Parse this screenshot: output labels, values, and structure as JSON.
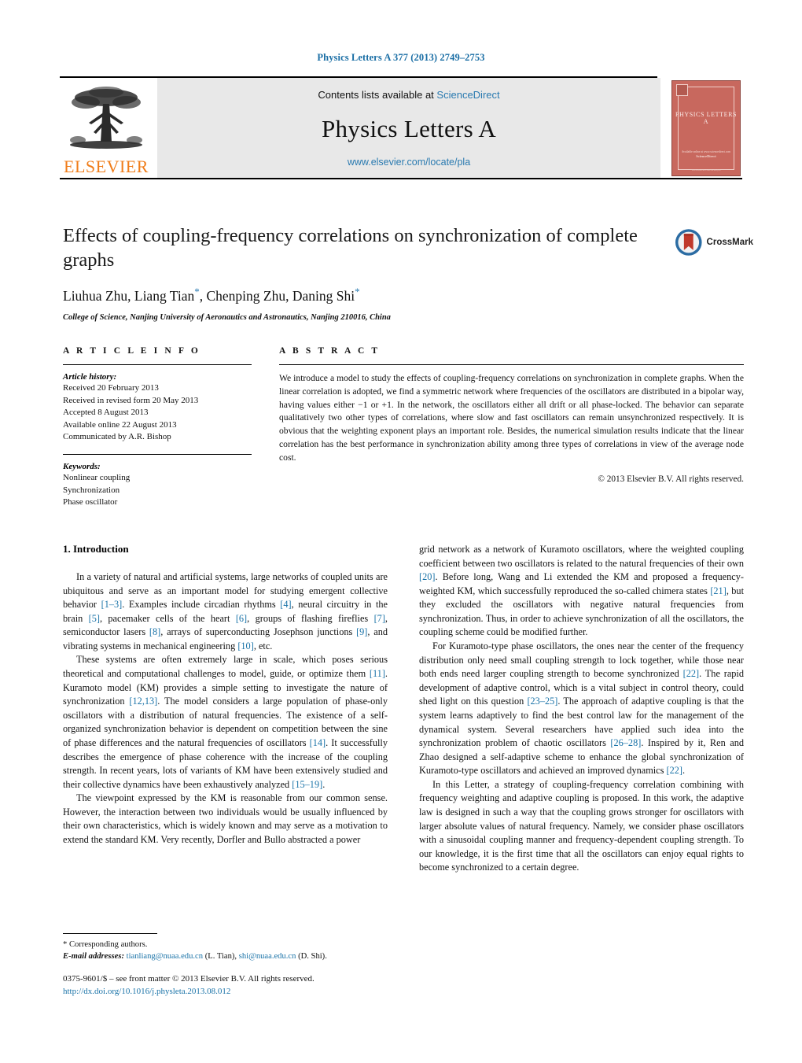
{
  "running_head": "Physics Letters A 377 (2013) 2749–2753",
  "masthead": {
    "contents_prefix": "Contents lists available at",
    "sciencedirect": "ScienceDirect",
    "journal_name": "Physics Letters A",
    "journal_url": "www.elsevier.com/locate/pla",
    "publisher_wordmark": "ELSEVIER",
    "cover_title": "PHYSICS LETTERS A",
    "cover_footer_line1": "Available online at www.sciencedirect.com",
    "cover_footer_line2": "ScienceDirect",
    "cover_bottom": "www.elsevier.com/locate/pla"
  },
  "article": {
    "title": "Effects of coupling-frequency correlations on synchronization of complete graphs",
    "authors": "Liuhua Zhu, Liang Tian",
    "authors_mid": ", Chenping Zhu, Daning Shi",
    "corresponding_mark": "*",
    "affiliation": "College of Science, Nanjing University of Aeronautics and Astronautics, Nanjing 210016, China",
    "crossmark_label": "CrossMark"
  },
  "info": {
    "heading": "A R T I C L E   I N F O",
    "history_label": "Article history:",
    "history": [
      "Received 20 February 2013",
      "Received in revised form 20 May 2013",
      "Accepted 8 August 2013",
      "Available online 22 August 2013",
      "Communicated by A.R. Bishop"
    ],
    "keywords_label": "Keywords:",
    "keywords": [
      "Nonlinear coupling",
      "Synchronization",
      "Phase oscillator"
    ]
  },
  "abstract": {
    "heading": "A B S T R A C T",
    "text": "We introduce a model to study the effects of coupling-frequency correlations on synchronization in complete graphs. When the linear correlation is adopted, we find a symmetric network where frequencies of the oscillators are distributed in a bipolar way, having values either −1 or +1. In the network, the oscillators either all drift or all phase-locked. The behavior can separate qualitatively two other types of correlations, where slow and fast oscillators can remain unsynchronized respectively. It is obvious that the weighting exponent plays an important role. Besides, the numerical simulation results indicate that the linear correlation has the best performance in synchronization ability among three types of correlations in view of the average node cost.",
    "copyright": "© 2013 Elsevier B.V. All rights reserved."
  },
  "body": {
    "section_title": "1. Introduction",
    "left_paragraphs": [
      {
        "parts": [
          {
            "t": "In a variety of natural and artificial systems, large networks of coupled units are ubiquitous and serve as an important model for studying emergent collective behavior "
          },
          {
            "t": "[1–3]",
            "ref": true
          },
          {
            "t": ". Examples include circadian rhythms "
          },
          {
            "t": "[4]",
            "ref": true
          },
          {
            "t": ", neural circuitry in the brain "
          },
          {
            "t": "[5]",
            "ref": true
          },
          {
            "t": ", pacemaker cells of the heart "
          },
          {
            "t": "[6]",
            "ref": true
          },
          {
            "t": ", groups of flashing fireflies "
          },
          {
            "t": "[7]",
            "ref": true
          },
          {
            "t": ", semiconductor lasers "
          },
          {
            "t": "[8]",
            "ref": true
          },
          {
            "t": ", arrays of superconducting Josephson junctions "
          },
          {
            "t": "[9]",
            "ref": true
          },
          {
            "t": ", and vibrating systems in mechanical engineering "
          },
          {
            "t": "[10]",
            "ref": true
          },
          {
            "t": ", etc."
          }
        ]
      },
      {
        "parts": [
          {
            "t": "These systems are often extremely large in scale, which poses serious theoretical and computational challenges to model, guide, or optimize them "
          },
          {
            "t": "[11]",
            "ref": true
          },
          {
            "t": ". Kuramoto model (KM) provides a simple setting to investigate the nature of synchronization "
          },
          {
            "t": "[12,13]",
            "ref": true
          },
          {
            "t": ". The model considers a large population of phase-only oscillators with a distribution of natural frequencies. The existence of a self-organized synchronization behavior is dependent on competition between the sine of phase differences and the natural frequencies of oscillators "
          },
          {
            "t": "[14]",
            "ref": true
          },
          {
            "t": ". It successfully describes the emergence of phase coherence with the increase of the coupling strength. In recent years, lots of variants of KM have been extensively studied and their collective dynamics have been exhaustively analyzed "
          },
          {
            "t": "[15–19]",
            "ref": true
          },
          {
            "t": "."
          }
        ]
      },
      {
        "parts": [
          {
            "t": "The viewpoint expressed by the KM is reasonable from our common sense. However, the interaction between two individuals would be usually influenced by their own characteristics, which is widely known and may serve as a motivation to extend the standard KM. Very recently, Dorfler and Bullo abstracted a power"
          }
        ]
      }
    ],
    "right_paragraphs": [
      {
        "no_indent": true,
        "parts": [
          {
            "t": "grid network as a network of Kuramoto oscillators, where the weighted coupling coefficient between two oscillators is related to the natural frequencies of their own "
          },
          {
            "t": "[20]",
            "ref": true
          },
          {
            "t": ". Before long, Wang and Li extended the KM and proposed a frequency-weighted KM, which successfully reproduced the so-called chimera states "
          },
          {
            "t": "[21]",
            "ref": true
          },
          {
            "t": ", but they excluded the oscillators with negative natural frequencies from synchronization. Thus, in order to achieve synchronization of all the oscillators, the coupling scheme could be modified further."
          }
        ]
      },
      {
        "parts": [
          {
            "t": "For Kuramoto-type phase oscillators, the ones near the center of the frequency distribution only need small coupling strength to lock together, while those near both ends need larger coupling strength to become synchronized "
          },
          {
            "t": "[22]",
            "ref": true
          },
          {
            "t": ". The rapid development of adaptive control, which is a vital subject in control theory, could shed light on this question "
          },
          {
            "t": "[23–25]",
            "ref": true
          },
          {
            "t": ". The approach of adaptive coupling is that the system learns adaptively to find the best control law for the management of the dynamical system. Several researchers have applied such idea into the synchronization problem of chaotic oscillators "
          },
          {
            "t": "[26–28]",
            "ref": true
          },
          {
            "t": ". Inspired by it, Ren and Zhao designed a self-adaptive scheme to enhance the global synchronization of Kuramoto-type oscillators and achieved an improved dynamics "
          },
          {
            "t": "[22]",
            "ref": true
          },
          {
            "t": "."
          }
        ]
      },
      {
        "parts": [
          {
            "t": "In this Letter, a strategy of coupling-frequency correlation combining with frequency weighting and adaptive coupling is proposed. In this work, the adaptive law is designed in such a way that the coupling grows stronger for oscillators with larger absolute values of natural frequency. Namely, we consider phase oscillators with a sinusoidal coupling manner and frequency-dependent coupling strength. To our knowledge, it is the first time that all the oscillators can enjoy equal rights to become synchronized to a certain degree."
          }
        ]
      }
    ]
  },
  "footnote": {
    "corresponding": "Corresponding authors.",
    "email_label": "E-mail addresses:",
    "email1": "tianliang@nuaa.edu.cn",
    "email1_person": "(L. Tian),",
    "email2": "shi@nuaa.edu.cn",
    "email2_person": "(D. Shi).",
    "imprint": "0375-9601/$ – see front matter © 2013 Elsevier B.V. All rights reserved.",
    "doi": "http://dx.doi.org/10.1016/j.physleta.2013.08.012"
  },
  "colors": {
    "link_blue": "#1a73a8",
    "header_blue": "#1a6ea5",
    "elsevier_orange": "#F07D1A",
    "cover_red": "#c8685e",
    "masthead_grey": "#e8e8e8"
  }
}
